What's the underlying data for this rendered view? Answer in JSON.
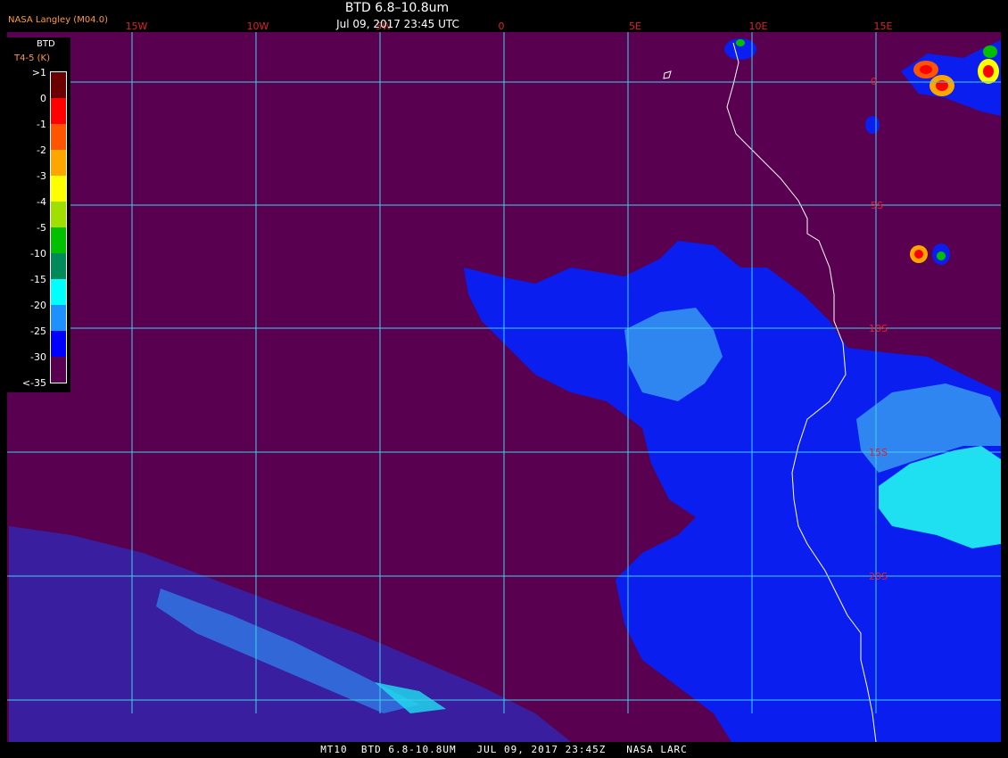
{
  "header": {
    "title": "BTD 6.8–10.8um",
    "timestamp": "Jul 09, 2017 23:45 UTC",
    "source": "NASA Langley (M04.0)"
  },
  "footer": {
    "caption": "MT10  BTD 6.8-10.8UM   JUL 09, 2017 23:45Z   NASA LARC"
  },
  "legend": {
    "title": "BTD",
    "units": "T4-5 (K)",
    "items": [
      {
        "label": ">1",
        "color": "#6b0000"
      },
      {
        "label": "0",
        "color": "#ff0000"
      },
      {
        "label": "-1",
        "color": "#ff5500"
      },
      {
        "label": "-2",
        "color": "#ffa500"
      },
      {
        "label": "-3",
        "color": "#ffff00"
      },
      {
        "label": "-4",
        "color": "#a0e000"
      },
      {
        "label": "-5",
        "color": "#00c000"
      },
      {
        "label": "-10",
        "color": "#008a5a"
      },
      {
        "label": "-15",
        "color": "#00ffff"
      },
      {
        "label": "-20",
        "color": "#1e90ff"
      },
      {
        "label": "-25",
        "color": "#0000ff"
      },
      {
        "label": "-30",
        "color": "#5a0050"
      },
      {
        "label": "<-35",
        "color": "#5a0050"
      }
    ]
  },
  "grid": {
    "line_color": "#3fd0e8",
    "label_color": "#e0202a",
    "longitude_labels": [
      "15W",
      "10W",
      "5W",
      "0",
      "5E",
      "10E",
      "15E"
    ],
    "latitude_labels": [
      "0",
      "5S",
      "10S",
      "15S",
      "20S"
    ]
  },
  "map": {
    "background_color": "#5a0050",
    "coastline_color": "#ffffff"
  }
}
